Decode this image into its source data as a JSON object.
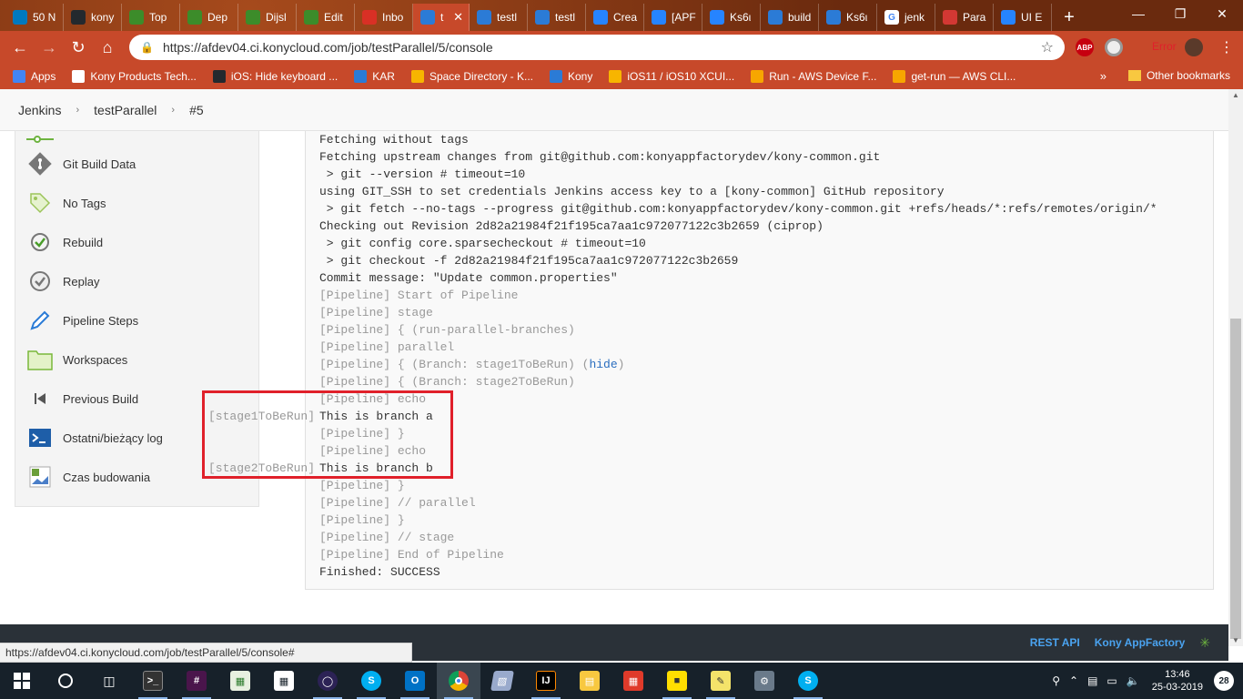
{
  "browser": {
    "tabs": [
      {
        "label": "50 N",
        "icon": "trello-icon",
        "color": "#0079bf"
      },
      {
        "label": "kony",
        "icon": "github-icon",
        "color": "#24292e"
      },
      {
        "label": "Top",
        "icon": "pluralsight-icon",
        "color": "#3c8c2a"
      },
      {
        "label": "Dep",
        "icon": "pluralsight-icon",
        "color": "#3c8c2a"
      },
      {
        "label": "Dijsl",
        "icon": "pluralsight-icon",
        "color": "#3c8c2a"
      },
      {
        "label": "Edit",
        "icon": "pluralsight-icon",
        "color": "#3c8c2a"
      },
      {
        "label": "Inbo",
        "icon": "gmail-icon",
        "color": "#d93025"
      },
      {
        "label": "t",
        "icon": "kony-icon",
        "color": "#2b7bd6",
        "active": true
      },
      {
        "label": "testl",
        "icon": "kony-icon",
        "color": "#2b7bd6"
      },
      {
        "label": "testl",
        "icon": "kony-icon",
        "color": "#2b7bd6"
      },
      {
        "label": "Crea",
        "icon": "jira-icon",
        "color": "#2684ff"
      },
      {
        "label": "[APF",
        "icon": "jira-icon",
        "color": "#2684ff"
      },
      {
        "label": "Ks6ι",
        "icon": "jira-icon",
        "color": "#2684ff"
      },
      {
        "label": "build",
        "icon": "kony-icon",
        "color": "#2b7bd6"
      },
      {
        "label": "Ks6ι",
        "icon": "kony-icon",
        "color": "#2b7bd6"
      },
      {
        "label": "jenk",
        "icon": "google-icon",
        "color": "#ffffff"
      },
      {
        "label": "Para",
        "icon": "jenkins-icon",
        "color": "#d33833"
      },
      {
        "label": "UI E",
        "icon": "confluence-icon",
        "color": "#2684ff"
      }
    ],
    "url": "https://afdev04.ci.konycloud.com/job/testParallel/5/console",
    "profile_label": "Error",
    "extension_abp": "ABP"
  },
  "bookmarks": {
    "items": [
      {
        "label": "Apps",
        "color": "#4285f4"
      },
      {
        "label": "Kony Products Tech...",
        "color": "#ffffff"
      },
      {
        "label": "iOS: Hide keyboard ...",
        "color": "#24292e"
      },
      {
        "label": "KAR",
        "color": "#2b7bd6"
      },
      {
        "label": "Space Directory - K...",
        "color": "#f7b500"
      },
      {
        "label": "Kony",
        "color": "#2b7bd6"
      },
      {
        "label": "iOS11 / iOS10 XCUI...",
        "color": "#f7b500"
      },
      {
        "label": "Run - AWS Device F...",
        "color": "#f7a600"
      },
      {
        "label": "get-run — AWS CLI...",
        "color": "#f7a600"
      }
    ],
    "more": "»",
    "other": "Other bookmarks"
  },
  "breadcrumb": {
    "items": [
      "Jenkins",
      "testParallel",
      "#5"
    ]
  },
  "sidebar": {
    "items": [
      {
        "label": "Git Build Data",
        "icon": "git-icon"
      },
      {
        "label": "No Tags",
        "icon": "tag-icon"
      },
      {
        "label": "Rebuild",
        "icon": "rebuild-icon"
      },
      {
        "label": "Replay",
        "icon": "replay-icon"
      },
      {
        "label": "Pipeline Steps",
        "icon": "pencil-icon"
      },
      {
        "label": "Workspaces",
        "icon": "folder-icon"
      },
      {
        "label": "Previous Build",
        "icon": "previous-icon"
      },
      {
        "label": "Ostatni/bieżący log",
        "icon": "terminal-icon"
      },
      {
        "label": "Czas budowania",
        "icon": "broken-image-icon"
      }
    ]
  },
  "console": {
    "lines": [
      {
        "text": "Fetching without tags",
        "pipe": false
      },
      {
        "text": "Fetching upstream changes from git@github.com:konyappfactorydev/kony-common.git",
        "pipe": false
      },
      {
        "text": " > git --version # timeout=10",
        "pipe": false
      },
      {
        "text": "using GIT_SSH to set credentials Jenkins access key to a [kony-common] GitHub repository",
        "pipe": false
      },
      {
        "text": " > git fetch --no-tags --progress git@github.com:konyappfactorydev/kony-common.git +refs/heads/*:refs/remotes/origin/*",
        "pipe": false
      },
      {
        "text": "Checking out Revision 2d82a21984f21f195ca7aa1c972077122c3b2659 (ciprop)",
        "pipe": false
      },
      {
        "text": " > git config core.sparsecheckout # timeout=10",
        "pipe": false
      },
      {
        "text": " > git checkout -f 2d82a21984f21f195ca7aa1c972077122c3b2659",
        "pipe": false
      },
      {
        "text": "Commit message: \"Update common.properties\"",
        "pipe": false
      },
      {
        "text": "[Pipeline] Start of Pipeline",
        "pipe": true
      },
      {
        "text": "[Pipeline] stage",
        "pipe": true
      },
      {
        "text": "[Pipeline] { (run-parallel-branches)",
        "pipe": true
      },
      {
        "text": "[Pipeline] parallel",
        "pipe": true
      },
      {
        "text": "[Pipeline] { (Branch: stage1ToBeRun) (",
        "pipe": true,
        "link": "hide",
        "suffix": ")"
      },
      {
        "text": "[Pipeline] { (Branch: stage2ToBeRun)",
        "pipe": true
      },
      {
        "text": "[Pipeline] echo",
        "pipe": true
      },
      {
        "text": "This is branch a",
        "pipe": false,
        "tag": "[stage1ToBeRun]"
      },
      {
        "text": "[Pipeline] }",
        "pipe": true
      },
      {
        "text": "[Pipeline] echo",
        "pipe": true
      },
      {
        "text": "This is branch b",
        "pipe": false,
        "tag": "[stage2ToBeRun]"
      },
      {
        "text": "[Pipeline] }",
        "pipe": true
      },
      {
        "text": "[Pipeline] // parallel",
        "pipe": true
      },
      {
        "text": "[Pipeline] }",
        "pipe": true
      },
      {
        "text": "[Pipeline] // stage",
        "pipe": true
      },
      {
        "text": "[Pipeline] End of Pipeline",
        "pipe": true
      },
      {
        "text": "Finished: SUCCESS",
        "pipe": false
      }
    ]
  },
  "footer": {
    "rest_api": "REST API",
    "brand": "Kony AppFactory"
  },
  "status_url": "https://afdev04.ci.konycloud.com/job/testParallel/5/console#",
  "taskbar": {
    "time": "13:46",
    "date": "25-03-2019",
    "notifications": "28"
  }
}
